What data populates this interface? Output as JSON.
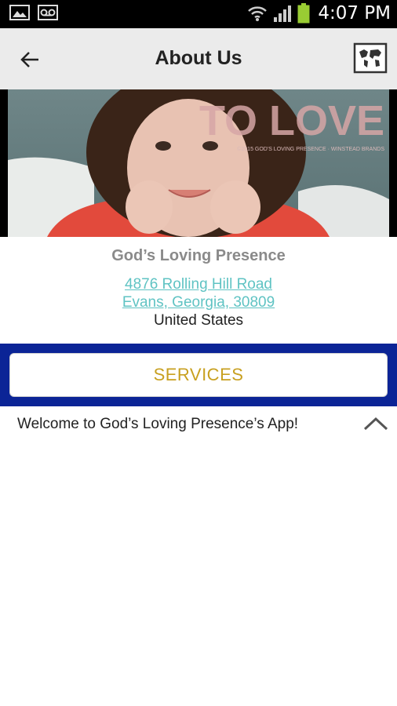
{
  "status_bar": {
    "time": "4:07 PM"
  },
  "app_bar": {
    "title": "About Us"
  },
  "banner": {
    "overlay_text": "TO LOVE",
    "overlay_subtext": "©2015 GOD'S LOVING PRESENCE · WINSTEAD BRANDS"
  },
  "info": {
    "name": "God’s Loving Presence",
    "address_line1": "4876 Rolling Hill Road",
    "address_line2": "Evans, Georgia, 30809",
    "country": "United States"
  },
  "services": {
    "label": "SERVICES"
  },
  "welcome": {
    "text": "Welcome to God’s Loving Presence’s App!"
  },
  "colors": {
    "band": "#0b2496",
    "services_text": "#c8a020",
    "link": "#5fc3c3",
    "appbar": "#ebebeb"
  },
  "icons": [
    "gallery-icon",
    "voicemail-icon",
    "wifi-icon",
    "signal-icon",
    "battery-icon",
    "back-arrow-icon",
    "map-icon",
    "chevron-up-icon"
  ]
}
